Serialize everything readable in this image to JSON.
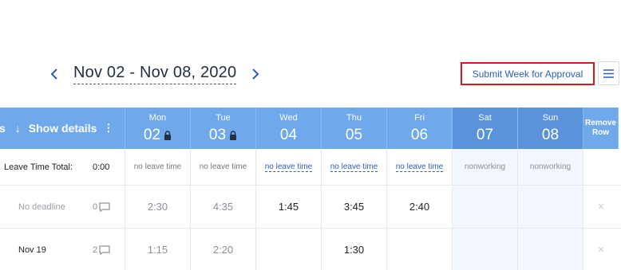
{
  "week": {
    "range": "Nov 02 - Nov 08, 2020"
  },
  "actions": {
    "submit_label": "Submit Week for Approval"
  },
  "header": {
    "left_partial": "s",
    "sort_arrow": "↓",
    "show_details": "Show details",
    "dots": "⋮",
    "remove_label_1": "Remove",
    "remove_label_2": "Row"
  },
  "days": [
    {
      "name": "Mon",
      "num": "02",
      "locked": true,
      "weekend": false
    },
    {
      "name": "Tue",
      "num": "03",
      "locked": true,
      "weekend": false
    },
    {
      "name": "Wed",
      "num": "04",
      "locked": false,
      "weekend": false
    },
    {
      "name": "Thu",
      "num": "05",
      "locked": false,
      "weekend": false
    },
    {
      "name": "Fri",
      "num": "06",
      "locked": false,
      "weekend": false
    },
    {
      "name": "Sat",
      "num": "07",
      "locked": false,
      "weekend": true
    },
    {
      "name": "Sun",
      "num": "08",
      "locked": false,
      "weekend": true
    }
  ],
  "leave": {
    "label": "Leave Time Total:",
    "total": "0:00",
    "cells": [
      "no leave time",
      "no leave time",
      "no leave time",
      "no leave time",
      "no leave time",
      "nonworking",
      "nonworking"
    ]
  },
  "rows": [
    {
      "deadline": "No deadline",
      "comments": "0",
      "hours": [
        "2:30",
        "4:35",
        "1:45",
        "3:45",
        "2:40",
        "",
        ""
      ],
      "remove": "×"
    },
    {
      "deadline": "Nov 19",
      "comments": "2",
      "hours": [
        "1:15",
        "2:20",
        "",
        "1:30",
        "",
        "",
        ""
      ],
      "remove": "×"
    }
  ],
  "colors": {
    "header_blue": "#6fa8eb",
    "weekend_blue": "#5a93dc",
    "link": "#2c5fb7",
    "highlight": "#e0141e"
  }
}
